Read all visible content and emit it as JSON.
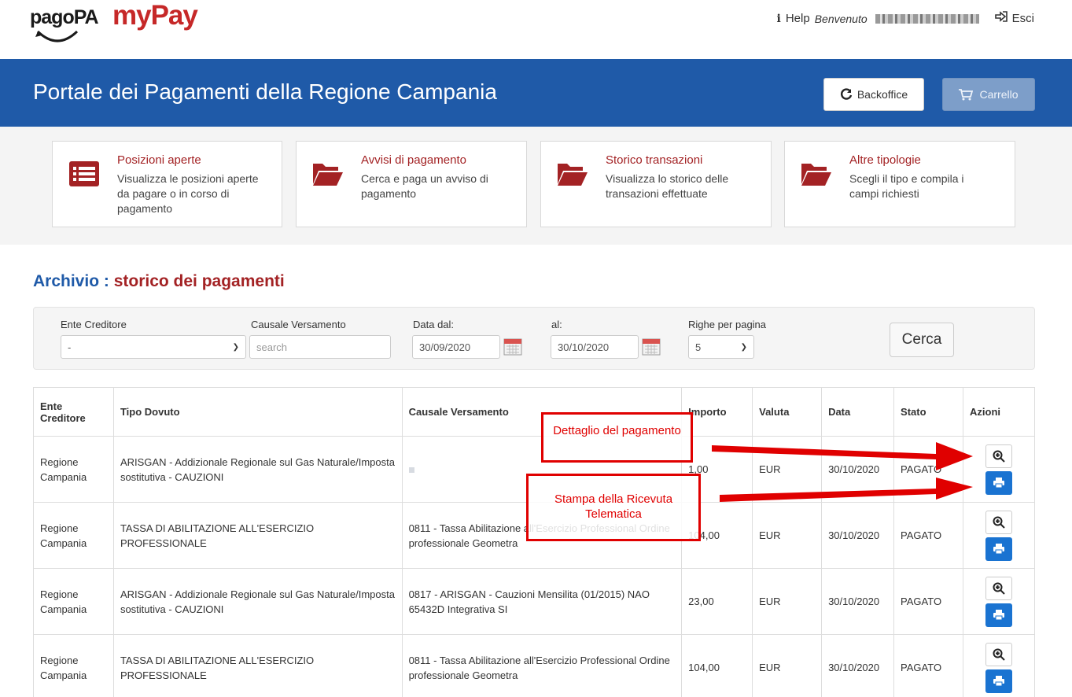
{
  "brand": {
    "pagopa": "pagoPA",
    "mypay": "myPay"
  },
  "userbar": {
    "help": "Help",
    "welcome": "Benvenuto",
    "logout": "Esci"
  },
  "header": {
    "title": "Portale dei Pagamenti della Regione Campania",
    "backoffice": "Backoffice",
    "carrello": "Carrello"
  },
  "tiles": [
    {
      "title": "Posizioni aperte",
      "desc": "Visualizza le posizioni aperte da pagare o in corso di pagamento",
      "icon": "list-icon"
    },
    {
      "title": "Avvisi di pagamento",
      "desc": "Cerca e paga un avviso di pagamento",
      "icon": "folder-open-icon"
    },
    {
      "title": "Storico transazioni",
      "desc": "Visualizza lo storico delle transazioni effettuate",
      "icon": "folder-open-icon"
    },
    {
      "title": "Altre tipologie",
      "desc": "Scegli il tipo e compila i campi richiesti",
      "icon": "folder-open-icon"
    }
  ],
  "archive": {
    "prefix": "Archivio :",
    "title": "storico dei pagamenti"
  },
  "filters": {
    "ente_label": "Ente Creditore",
    "ente_value": "-",
    "causale_label": "Causale Versamento",
    "causale_placeholder": "search",
    "data_dal_label": "Data dal:",
    "data_dal_value": "30/09/2020",
    "al_label": "al:",
    "al_value": "30/10/2020",
    "righe_label": "Righe per pagina",
    "righe_value": "5",
    "cerca": "Cerca"
  },
  "table": {
    "headers": [
      "Ente Creditore",
      "Tipo Dovuto",
      "Causale Versamento",
      "Importo",
      "Valuta",
      "Data",
      "Stato",
      "Azioni"
    ],
    "rows": [
      {
        "ente": "Regione Campania",
        "tipo": "ARISGAN - Addizionale Regionale sul Gas Naturale/Imposta sostitutiva - CAUZIONI",
        "causale": "",
        "importo": "1,00",
        "valuta": "EUR",
        "data": "30/10/2020",
        "stato": "PAGATO"
      },
      {
        "ente": "Regione Campania",
        "tipo": "TASSA DI ABILITAZIONE ALL'ESERCIZIO PROFESSIONALE",
        "causale": "0811 - Tassa Abilitazione all'Esercizio Professional Ordine professionale Geometra",
        "importo": "104,00",
        "valuta": "EUR",
        "data": "30/10/2020",
        "stato": "PAGATO"
      },
      {
        "ente": "Regione Campania",
        "tipo": "ARISGAN - Addizionale Regionale sul Gas Naturale/Imposta sostitutiva - CAUZIONI",
        "causale": "0817 - ARISGAN - Cauzioni Mensilita (01/2015) NAO 65432D Integrativa SI",
        "importo": "23,00",
        "valuta": "EUR",
        "data": "30/10/2020",
        "stato": "PAGATO"
      },
      {
        "ente": "Regione Campania",
        "tipo": "TASSA DI ABILITAZIONE ALL'ESERCIZIO PROFESSIONALE",
        "causale": "0811 - Tassa Abilitazione all'Esercizio Professional Ordine professionale Geometra",
        "importo": "104,00",
        "valuta": "EUR",
        "data": "30/10/2020",
        "stato": "PAGATO"
      }
    ]
  },
  "annotations": {
    "dettaglio": "Dettaglio del pagamento",
    "stampa": "Stampa della Ricevuta Telematica"
  },
  "colors": {
    "primary": "#1f5aa8",
    "accent_red": "#a32224",
    "annotation_red": "#e00000",
    "print_blue": "#1a73d1"
  }
}
